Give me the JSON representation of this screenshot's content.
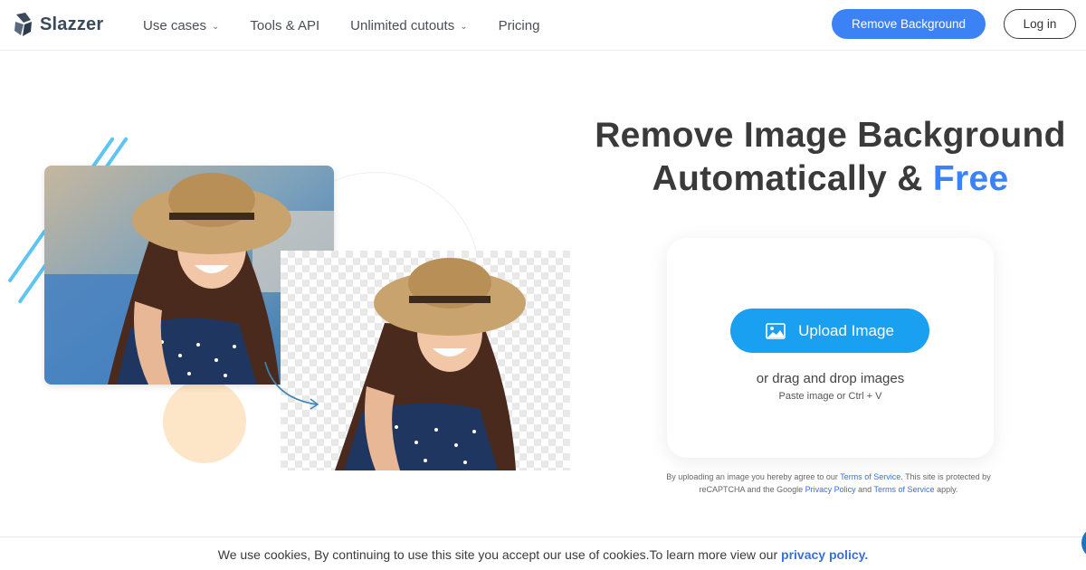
{
  "header": {
    "logo_text": "Slazzer",
    "nav": [
      {
        "label": "Use cases",
        "has_dropdown": true
      },
      {
        "label": "Tools & API",
        "has_dropdown": false
      },
      {
        "label": "Unlimited cutouts",
        "has_dropdown": true
      },
      {
        "label": "Pricing",
        "has_dropdown": false
      }
    ],
    "cta_label": "Remove Background",
    "login_label": "Log in"
  },
  "hero": {
    "headline_line1": "Remove Image Background",
    "headline_line2_prefix": "Automatically &",
    "headline_accent": "Free"
  },
  "upload": {
    "button_label": "Upload Image",
    "icon": "image-icon",
    "drag_text": "or drag and drop images",
    "paste_text": "Paste image or Ctrl + V"
  },
  "legal": {
    "part1": "By uploading an image you hereby agree to our",
    "terms_link": "Terms of Service",
    "part2": ". This site is protected by reCAPTCHA and the Google",
    "privacy_link": "Privacy Policy",
    "part3": "and",
    "terms_link2": "Terms of Service",
    "part4": "apply."
  },
  "cookie": {
    "text": "We use cookies, By continuing to use this site you accept our use of cookies.To learn more view our",
    "link": "privacy policy."
  },
  "colors": {
    "accent": "#3b82f6",
    "upload": "#1aa0f0",
    "peach": "#fde5c8",
    "stripes": "#5ec5f2"
  }
}
